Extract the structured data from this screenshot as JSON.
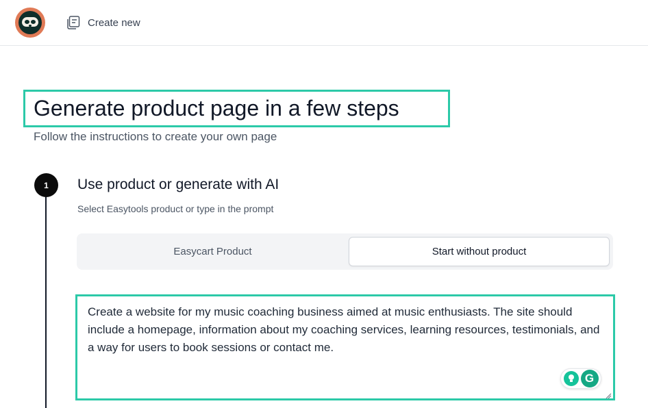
{
  "topbar": {
    "create_new_label": "Create new",
    "icons": {
      "logo": "sloth-logo",
      "create_new": "document-stack-icon"
    }
  },
  "header": {
    "title": "Generate product page in a few steps",
    "subtitle": "Follow the instructions to create your own page"
  },
  "step1": {
    "number": "1",
    "title": "Use product or generate with AI",
    "description": "Select Easytools product or type in the prompt",
    "toggle": {
      "options": [
        "Easycart Product",
        "Start without product"
      ],
      "selected": "Start without product"
    }
  },
  "prompt": {
    "value": "Create a website for my music coaching business aimed at music enthusiasts. The site should include a homepage, information about my coaching services, learning resources, testimonials, and a way for users to book sessions or contact me.",
    "widget_letter": "G"
  },
  "colors": {
    "highlight": "#2cc9a8",
    "logo_orange": "#e07a56",
    "logo_dark": "#0f2e2a",
    "grammarly_green": "#15c39a"
  }
}
